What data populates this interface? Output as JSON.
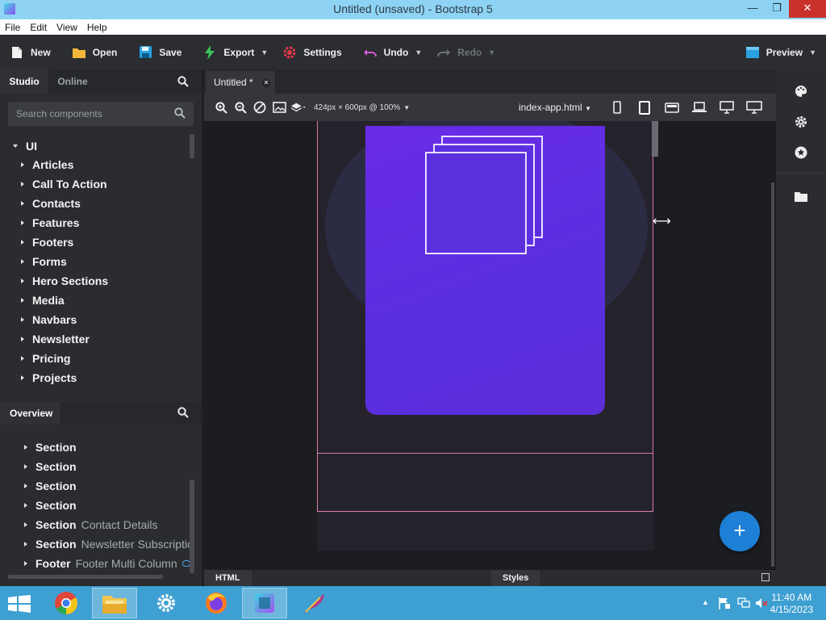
{
  "window": {
    "title": "Untitled (unsaved) - Bootstrap 5",
    "min": "—",
    "max": "❐",
    "close": "✕"
  },
  "menu": [
    "File",
    "Edit",
    "View",
    "Help"
  ],
  "toolbar": {
    "new": "New",
    "open": "Open",
    "save": "Save",
    "export": "Export",
    "settings": "Settings",
    "undo": "Undo",
    "redo": "Redo",
    "preview": "Preview"
  },
  "left_panel": {
    "tabs": [
      "Studio",
      "Online"
    ],
    "search_placeholder": "Search components",
    "root": "UI",
    "items": [
      "Articles",
      "Call To Action",
      "Contacts",
      "Features",
      "Footers",
      "Forms",
      "Hero Sections",
      "Media",
      "Navbars",
      "Newsletter",
      "Pricing",
      "Projects"
    ]
  },
  "overview": {
    "title": "Overview",
    "items": [
      {
        "label": "Section",
        "extra": ""
      },
      {
        "label": "Section",
        "extra": ""
      },
      {
        "label": "Section",
        "extra": ""
      },
      {
        "label": "Section",
        "extra": ""
      },
      {
        "label": "Section",
        "extra": "Contact Details"
      },
      {
        "label": "Section",
        "extra": "Newsletter Subscription"
      },
      {
        "label": "Footer",
        "extra": "Footer Multi Column"
      }
    ]
  },
  "editor": {
    "tab_label": "Untitled *",
    "size_label": "424px × 600px @ 100%",
    "file": "index-app.html",
    "bottom_html": "HTML",
    "bottom_styles": "Styles",
    "fab": "+"
  },
  "taskbar": {
    "time": "11:40 AM",
    "date": "4/15/2023"
  },
  "colors": {
    "accent": "#1e7fd6",
    "card": "#5a2fe0",
    "selection": "#d87aa8",
    "taskbar": "#3d9fd2"
  }
}
